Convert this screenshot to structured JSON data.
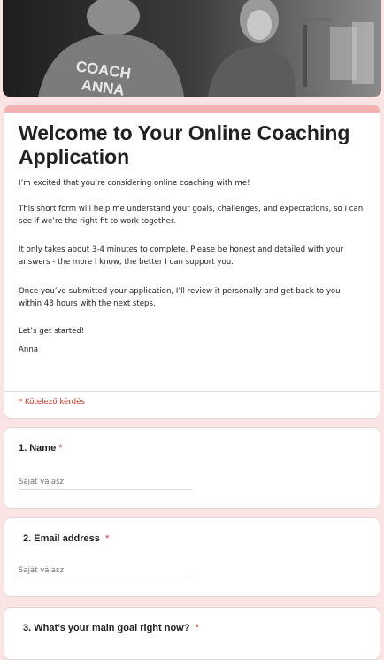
{
  "banner": {
    "shirt_line1": "COACH",
    "shirt_line2": "ANNA"
  },
  "intro": {
    "title": "Welcome to Your Online Coaching Application",
    "paragraphs": [
      "I’m excited that you’re considering online coaching with me!",
      "This short form will help me understand your goals, challenges, and expectations, so I can see if we’re the right fit to work together.",
      "It only takes about 3-4 minutes to complete. Please be honest and detailed with your answers - the more I know, the better I can support you.",
      "Once you’ve submitted your application, I’ll review it personally and get back to you within 48 hours with the next steps.",
      "Let’s get started!",
      "Anna"
    ],
    "required_note": "* Kötelező kérdés"
  },
  "questions": [
    {
      "title": "1. Name",
      "required_mark": "*",
      "placeholder": "Saját válasz"
    },
    {
      "title": "2. Email address",
      "required_mark": "*",
      "placeholder": "Saját válasz"
    },
    {
      "title": "3. What’s your main goal right now?",
      "required_mark": "*"
    }
  ],
  "colors": {
    "page_bg": "#fbe4e4",
    "accent": "#f6b1b1",
    "required": "#d93025"
  }
}
